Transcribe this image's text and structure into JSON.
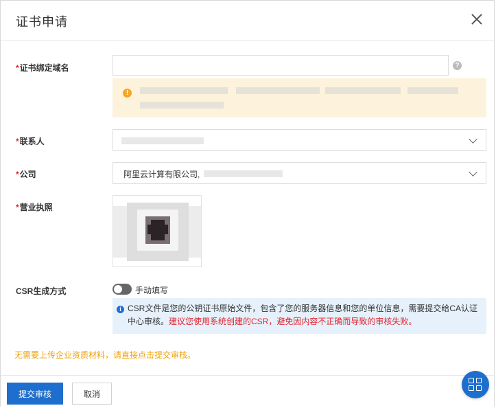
{
  "dialog": {
    "title": "证书申请"
  },
  "form": {
    "domain": {
      "required_mark": "*",
      "label": "证书绑定域名",
      "value": "",
      "placeholder": ""
    },
    "contact": {
      "required_mark": "*",
      "label": "联系人"
    },
    "company": {
      "required_mark": "*",
      "label": "公司",
      "value": "阿里云计算有限公司,"
    },
    "license": {
      "required_mark": "*",
      "label": "营业执照"
    },
    "csr": {
      "label": "CSR生成方式",
      "toggle_label": "手动填写",
      "info_text": "CSR文件是您的公钥证书原始文件，包含了您的服务器信息和您的单位信息，需要提交给CA认证中心审核。",
      "info_warning": "建议您使用系统创建的CSR，避免因内容不正确而导致的审核失败。"
    }
  },
  "note": "无需要上传企业资质材料，请直接点击提交审核。",
  "footer": {
    "submit_label": "提交审核",
    "cancel_label": "取消"
  },
  "icons": {
    "help": "question-icon",
    "warning": "warning-icon",
    "info": "info-icon",
    "close": "close-icon",
    "fab": "grid-icon"
  },
  "colors": {
    "primary": "#1e6ecd",
    "required": "#e0242e",
    "warning_bg": "#fdf3dc",
    "info_bg": "#e6f1fb",
    "note": "#f0a20a"
  }
}
